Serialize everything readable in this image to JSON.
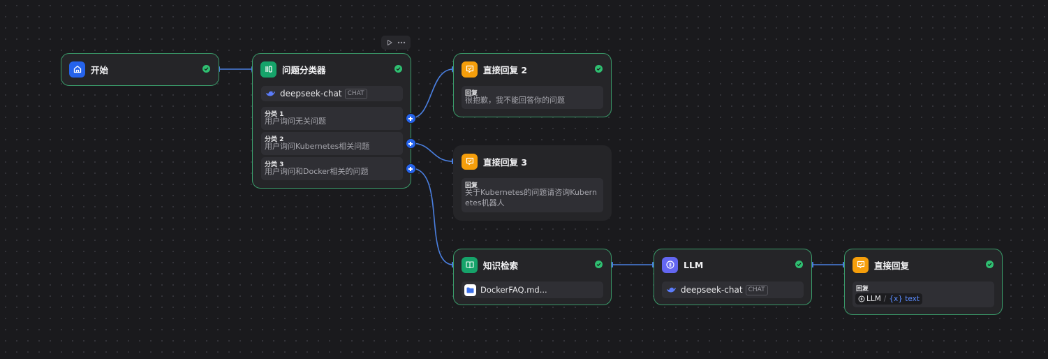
{
  "toolbar": {
    "run_icon": "play-icon",
    "more_icon": "more-icon"
  },
  "colors": {
    "blue_icon": "#2563eb",
    "green_icon": "#16a36a",
    "orange_icon": "#f59e0b",
    "llm_icon": "#6366f1",
    "selected_border": "#3a9b6a",
    "status_ok": "#2fbf71",
    "edge": "#4a7fe0"
  },
  "nodes": {
    "start": {
      "title": "开始",
      "icon": "home-icon"
    },
    "classifier": {
      "title": "问题分类器",
      "icon": "classifier-icon",
      "model": "deepseek-chat",
      "model_badge": "CHAT",
      "classes": [
        {
          "label": "分类 1",
          "text": "用户询问无关问题"
        },
        {
          "label": "分类 2",
          "text": "用户询问Kubernetes相关问题"
        },
        {
          "label": "分类 3",
          "text": "用户询问和Docker相关的问题"
        }
      ]
    },
    "answer2": {
      "title": "直接回复 2",
      "icon": "answer-icon",
      "label": "回复",
      "text": "很抱歉，我不能回答你的问题"
    },
    "answer3": {
      "title": "直接回复 3",
      "icon": "answer-icon",
      "label": "回复",
      "text_line1": "关于Kubernetes的问题请咨询Kubern",
      "text_line2": "etes机器人"
    },
    "knowledge": {
      "title": "知识检索",
      "icon": "book-icon",
      "dataset": "DockerFAQ.md..."
    },
    "llm": {
      "title": "LLM",
      "icon": "llm-icon",
      "model": "deepseek-chat",
      "model_badge": "CHAT"
    },
    "answer": {
      "title": "直接回复",
      "icon": "answer-icon",
      "label": "回复",
      "ref_node": "LLM",
      "ref_sep": "/",
      "ref_var": "{x} text"
    }
  }
}
